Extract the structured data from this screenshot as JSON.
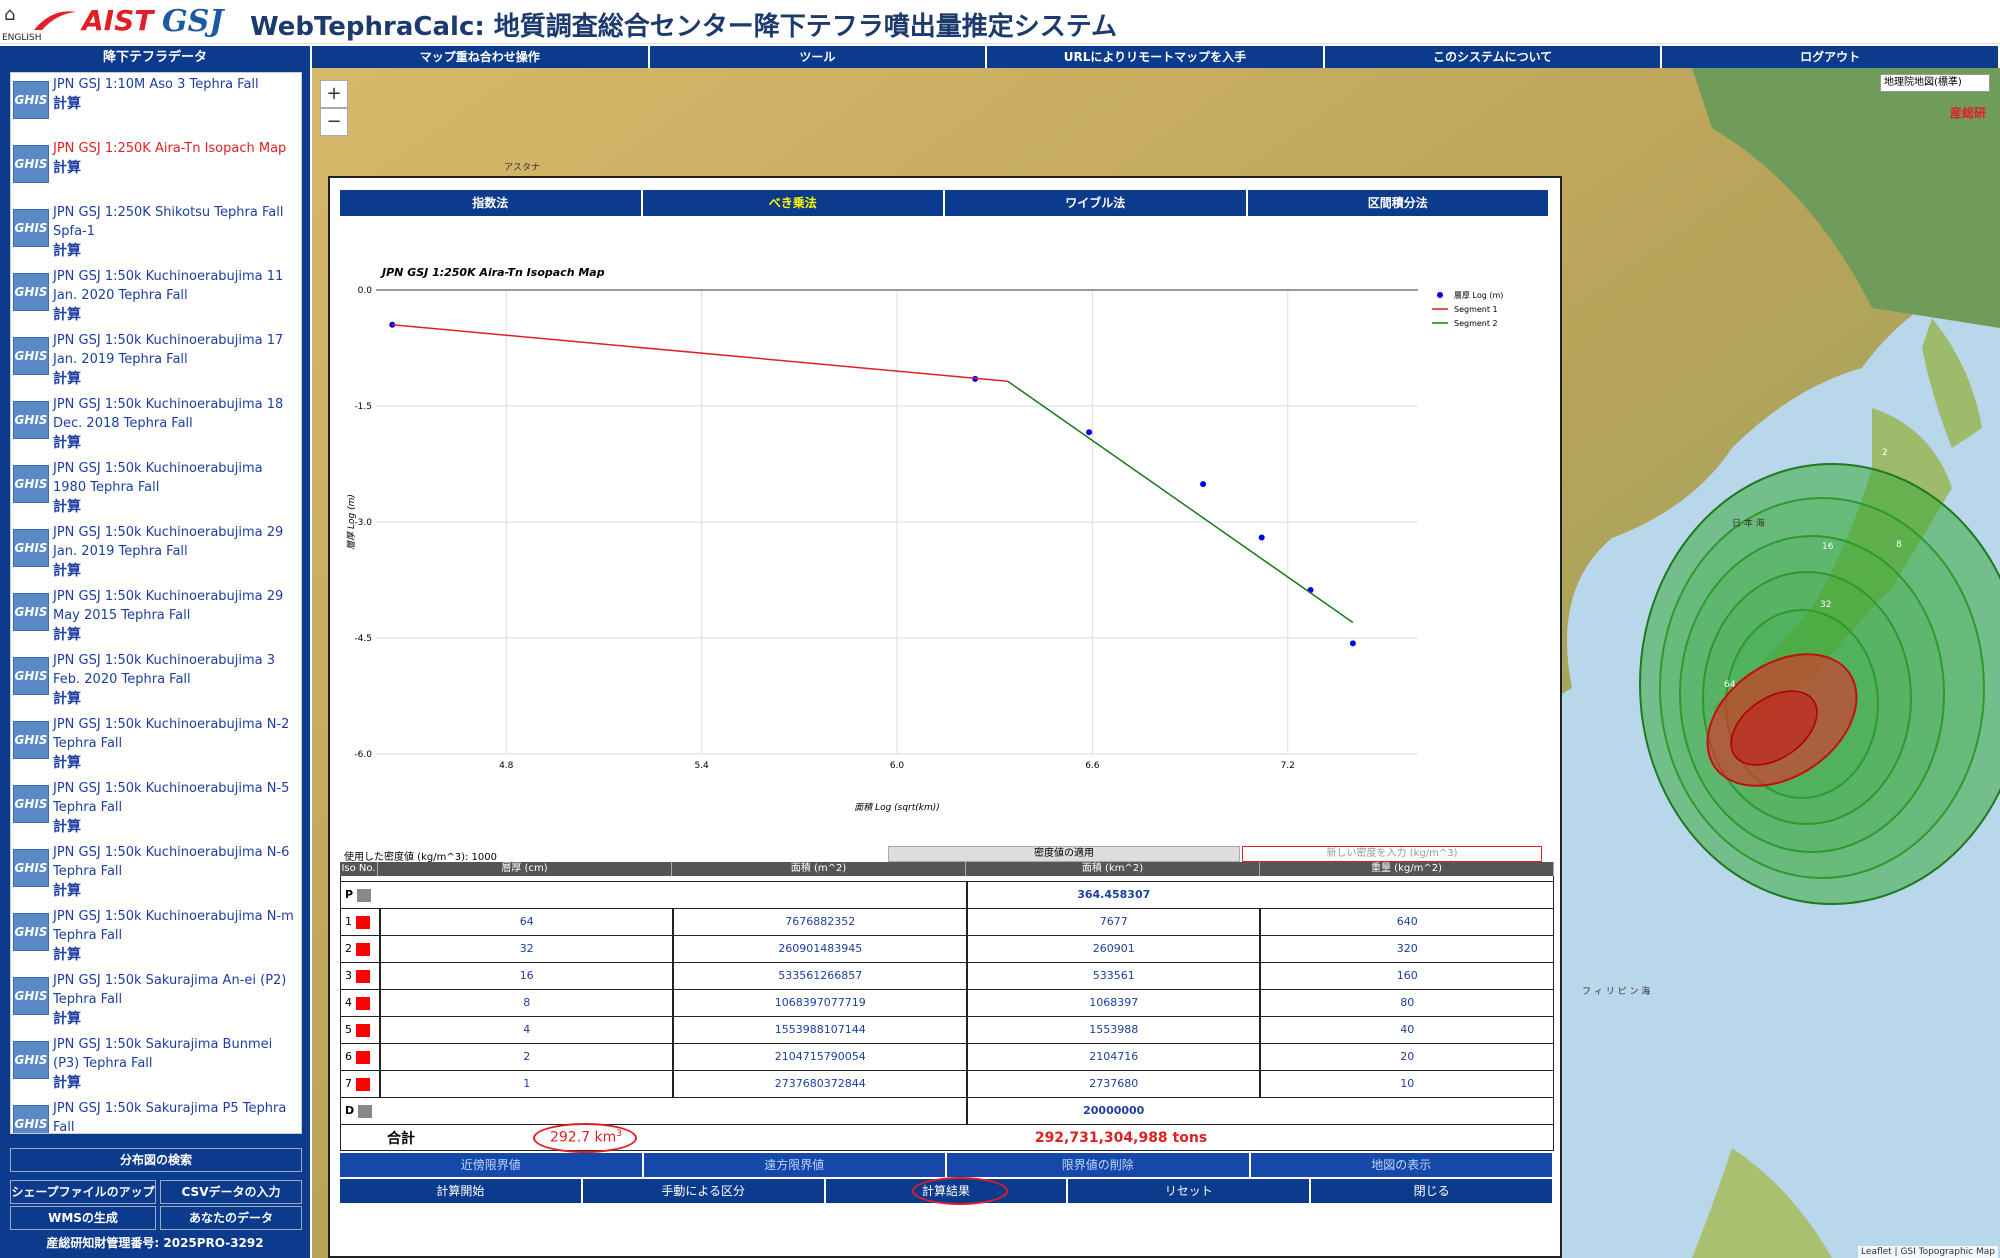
{
  "header": {
    "home_icon": "home-icon",
    "english": "ENGLISH",
    "aist": "AIST",
    "gsj": "GSJ",
    "title": "WebTephraCalc: 地質調査総合センター降下テフラ噴出量推定システム"
  },
  "sidebar": {
    "title": "降下テフラデータ",
    "calc_label": "計算",
    "ghis": "GHIS",
    "items": [
      {
        "text": "JPN GSJ 1:10M Aso 3 Tephra Fall"
      },
      {
        "text": "JPN GSJ 1:250K Aira-Tn Isopach Map"
      },
      {
        "text": "JPN GSJ 1:250K Shikotsu Tephra Fall Spfa-1"
      },
      {
        "text": "JPN GSJ 1:50k Kuchinoerabujima 11 Jan. 2020 Tephra Fall"
      },
      {
        "text": "JPN GSJ 1:50k Kuchinoerabujima 17 Jan. 2019 Tephra Fall"
      },
      {
        "text": "JPN GSJ 1:50k Kuchinoerabujima 18 Dec. 2018 Tephra Fall"
      },
      {
        "text": "JPN GSJ 1:50k Kuchinoerabujima 1980 Tephra Fall"
      },
      {
        "text": "JPN GSJ 1:50k Kuchinoerabujima 29 Jan. 2019 Tephra Fall"
      },
      {
        "text": "JPN GSJ 1:50k Kuchinoerabujima 29 May 2015 Tephra Fall"
      },
      {
        "text": "JPN GSJ 1:50k Kuchinoerabujima 3 Feb. 2020 Tephra Fall"
      },
      {
        "text": "JPN GSJ 1:50k Kuchinoerabujima N-2 Tephra Fall"
      },
      {
        "text": "JPN GSJ 1:50k Kuchinoerabujima N-5 Tephra Fall"
      },
      {
        "text": "JPN GSJ 1:50k Kuchinoerabujima N-6 Tephra Fall"
      },
      {
        "text": "JPN GSJ 1:50k Kuchinoerabujima N-m Tephra Fall"
      },
      {
        "text": "JPN GSJ 1:50k Sakurajima An-ei (P2) Tephra Fall"
      },
      {
        "text": "JPN GSJ 1:50k Sakurajima Bunmei (P3) Tephra Fall"
      },
      {
        "text": "JPN GSJ 1:50k Sakurajima P5 Tephra Fall"
      }
    ],
    "search_btn": "分布図の検索",
    "shape_btn": "シェープファイルのアップ",
    "csv_btn": "CSVデータの入力",
    "wms_btn": "WMSの生成",
    "mydata_btn": "あなたのデータ",
    "footer": "産総研知財管理番号: 2025PRO-3292"
  },
  "nav": [
    "マップ重ね合わせ操作",
    "ツール",
    "URLによりリモートマップを入手",
    "このシステムについて",
    "ログアウト"
  ],
  "map": {
    "zoom_in": "+",
    "zoom_out": "−",
    "maptype": "地理院地図(標準)",
    "aist_small": "産総研",
    "attribution": "Leaflet | GSI Topographic Map",
    "contour_labels": [
      "2",
      "8",
      "16",
      "32",
      "64"
    ],
    "place_labels": [
      "アスタナ",
      "日 本 海",
      "フ ィ リ ピ ン 海"
    ]
  },
  "panel": {
    "tabs": [
      "指数法",
      "べき乗法",
      "ワイブル法",
      "区間積分法"
    ],
    "active_tab": 1,
    "density_label": "使用した密度値 (kg/m^3): 1000",
    "density_apply": "密度値の適用",
    "density_placeholder": "新しい密度を入力 (kg/m^3)",
    "headers": [
      "Iso No.",
      "層厚 (cm)",
      "面積 (m^2)",
      "面積 (km^2)",
      "重量 (kg/m^2)"
    ],
    "rows": [
      {
        "iso": "P",
        "color": "#888888",
        "thick": "",
        "area_m": "",
        "area_km": "364.458307",
        "mass": ""
      },
      {
        "iso": "1",
        "color": "#ff0000",
        "thick": "64",
        "area_m": "7676882352",
        "area_km": "7677",
        "mass": "640"
      },
      {
        "iso": "2",
        "color": "#ff0000",
        "thick": "32",
        "area_m": "260901483945",
        "area_km": "260901",
        "mass": "320"
      },
      {
        "iso": "3",
        "color": "#ff0000",
        "thick": "16",
        "area_m": "533561266857",
        "area_km": "533561",
        "mass": "160"
      },
      {
        "iso": "4",
        "color": "#ff0000",
        "thick": "8",
        "area_m": "1068397077719",
        "area_km": "1068397",
        "mass": "80"
      },
      {
        "iso": "5",
        "color": "#ff0000",
        "thick": "4",
        "area_m": "1553988107144",
        "area_km": "1553988",
        "mass": "40"
      },
      {
        "iso": "6",
        "color": "#ff0000",
        "thick": "2",
        "area_m": "2104715790054",
        "area_km": "2104716",
        "mass": "20"
      },
      {
        "iso": "7",
        "color": "#ff0000",
        "thick": "1",
        "area_m": "2737680372844",
        "area_km": "2737680",
        "mass": "10"
      },
      {
        "iso": "D",
        "color": "#888888",
        "thick": "",
        "area_m": "",
        "area_km": "20000000",
        "mass": ""
      }
    ],
    "total_label": "合計",
    "total_volume": "292.7 km",
    "total_volume_sup": "3",
    "total_mass": "292,731,304,988 tons",
    "buttons1": [
      "近傍限界値",
      "遠方限界値",
      "限界値の削除",
      "地図の表示"
    ],
    "buttons2": [
      "計算開始",
      "手動による区分",
      "計算結果",
      "リセット",
      "閉じる"
    ]
  },
  "chart_data": {
    "type": "scatter",
    "title": "JPN GSJ 1:250K Aira-Tn Isopach Map",
    "xlabel": "面積 Log (sqrt(km))",
    "ylabel": "層厚 Log (m)",
    "xlim": [
      4.4,
      7.6
    ],
    "ylim": [
      -6.0,
      0.0
    ],
    "xticks": [
      4.8,
      5.4,
      6.0,
      6.6,
      7.2
    ],
    "yticks": [
      0.0,
      -1.5,
      -3.0,
      -4.5,
      -6.0
    ],
    "grid": true,
    "legend_position": "top-right",
    "series": [
      {
        "name": "層厚 Log (m)",
        "kind": "points",
        "color": "#0000ee",
        "x": [
          4.45,
          6.24,
          6.59,
          6.94,
          7.12,
          7.27,
          7.4
        ],
        "y": [
          -0.45,
          -1.15,
          -1.84,
          -2.51,
          -3.2,
          -3.88,
          -4.57
        ]
      },
      {
        "name": "Segment 1",
        "kind": "line",
        "color": "#e02020",
        "x": [
          4.45,
          6.34
        ],
        "y": [
          -0.45,
          -1.18
        ]
      },
      {
        "name": "Segment 2",
        "kind": "line",
        "color": "#1a7a1a",
        "x": [
          6.34,
          7.4
        ],
        "y": [
          -1.18,
          -4.3
        ]
      }
    ]
  }
}
